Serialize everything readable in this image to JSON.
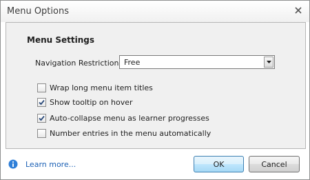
{
  "window": {
    "title": "Menu Options",
    "close_icon": "close-icon"
  },
  "settings": {
    "section_title": "Menu Settings",
    "navigation_restriction": {
      "label": "Navigation Restriction:",
      "value": "Free"
    },
    "options": [
      {
        "label": "Wrap long menu item titles",
        "checked": false
      },
      {
        "label": "Show tooltip on hover",
        "checked": true
      },
      {
        "label": "Auto-collapse menu as learner progresses",
        "checked": true
      },
      {
        "label": "Number entries in the menu automatically",
        "checked": false
      }
    ]
  },
  "footer": {
    "info_icon": "info-icon",
    "learn_more": "Learn more...",
    "ok_label": "OK",
    "cancel_label": "Cancel"
  },
  "colors": {
    "panel_bg": "#f0f0f0",
    "link": "#1a5fb4",
    "info_icon": "#2f7fd8",
    "checkmark": "#2a4a7a"
  }
}
